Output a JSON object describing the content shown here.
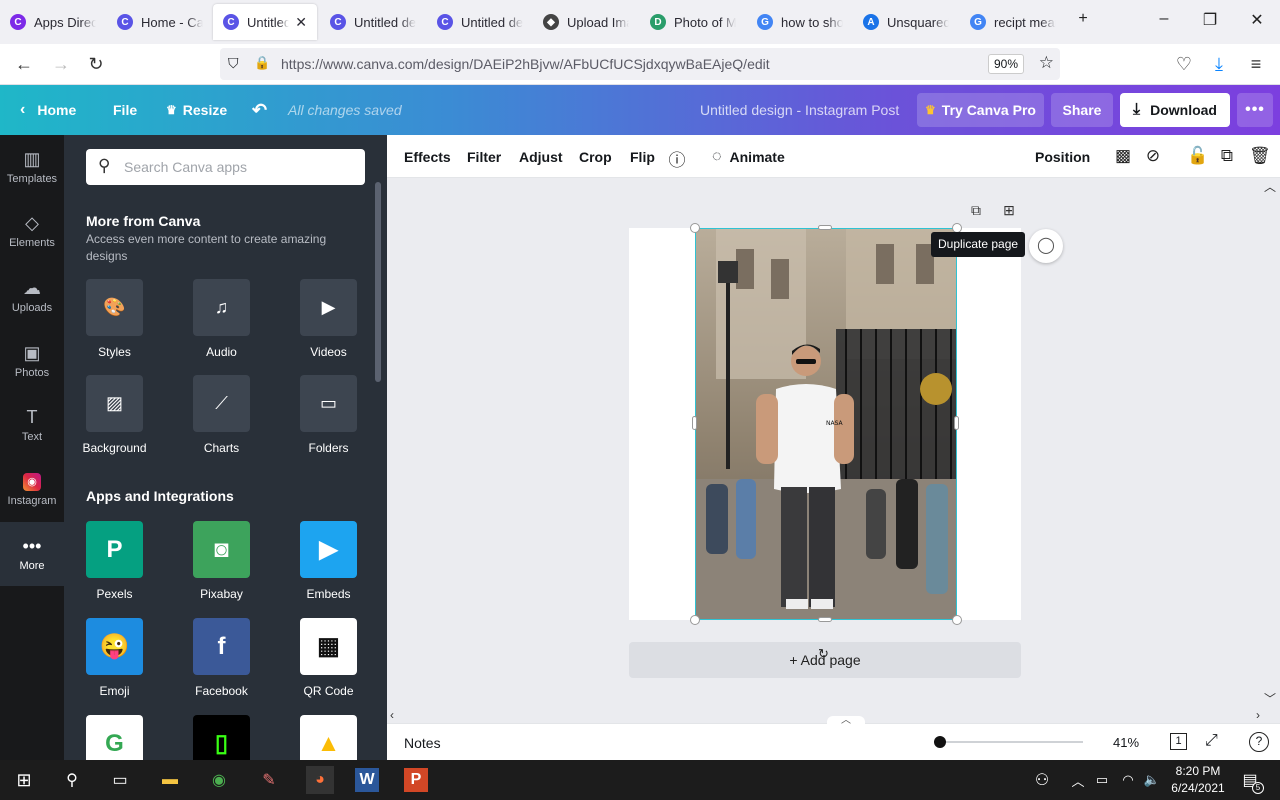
{
  "browser": {
    "tabs": [
      {
        "title": "Apps Directory",
        "fav": "C",
        "color": "#7d2ae8",
        "active": false
      },
      {
        "title": "Home - Canva",
        "fav": "C",
        "color": "#5a54e6",
        "active": false
      },
      {
        "title": "Untitled design",
        "fav": "C",
        "color": "#5a54e6",
        "active": true
      },
      {
        "title": "Untitled design",
        "fav": "C",
        "color": "#5a54e6",
        "active": false
      },
      {
        "title": "Untitled design",
        "fav": "C",
        "color": "#5a54e6",
        "active": false
      },
      {
        "title": "Upload Images",
        "fav": "◆",
        "color": "#444444",
        "active": false
      },
      {
        "title": "Photo of Man",
        "fav": "D",
        "color": "#2a9d6a",
        "active": false
      },
      {
        "title": "how to show",
        "fav": "G",
        "color": "#4285f4",
        "active": false
      },
      {
        "title": "Unsquared",
        "fav": "A",
        "color": "#1a73e8",
        "active": false
      },
      {
        "title": "recipt meaning",
        "fav": "G",
        "color": "#4285f4",
        "active": false
      }
    ],
    "url": "https://www.canva.com/design/DAEiP2hBjvw/AFbUCfUCSjdxqywBaEAjeQ/edit",
    "zoom": "90%"
  },
  "header": {
    "home": "Home",
    "file": "File",
    "resize": "Resize",
    "status": "All changes saved",
    "design_title": "Untitled design - Instagram Post",
    "try_pro": "Try Canva Pro",
    "share": "Share",
    "download": "Download"
  },
  "rail": [
    {
      "label": "Templates",
      "icon": "▥"
    },
    {
      "label": "Elements",
      "icon": "◇"
    },
    {
      "label": "Uploads",
      "icon": "☁"
    },
    {
      "label": "Photos",
      "icon": "▣"
    },
    {
      "label": "Text",
      "icon": "T"
    },
    {
      "label": "Instagram",
      "icon": "◉"
    },
    {
      "label": "More",
      "icon": "•••"
    }
  ],
  "panel": {
    "search_placeholder": "Search Canva apps",
    "more_title": "More from Canva",
    "more_sub": "Access even more content to create amazing designs",
    "more_items": [
      {
        "label": "Styles",
        "icon": "🎨"
      },
      {
        "label": "Audio",
        "icon": "♫"
      },
      {
        "label": "Videos",
        "icon": "▶"
      },
      {
        "label": "Background",
        "icon": "▨"
      },
      {
        "label": "Charts",
        "icon": "⟋"
      },
      {
        "label": "Folders",
        "icon": "▭"
      }
    ],
    "apps_title": "Apps and Integrations",
    "apps": [
      {
        "label": "Pexels",
        "icon": "P",
        "color": "#05a081"
      },
      {
        "label": "Pixabay",
        "icon": "◙",
        "color": "#3da35c"
      },
      {
        "label": "Embeds",
        "icon": "▶",
        "color": "#1da4f0"
      },
      {
        "label": "Emoji",
        "icon": "😜",
        "color": "#1d8ce0"
      },
      {
        "label": "Facebook",
        "icon": "f",
        "color": "#3b5998"
      },
      {
        "label": "QR Code",
        "icon": "▦",
        "color": "#ffffff"
      },
      {
        "label": "",
        "icon": "G",
        "color": "#ffffff"
      },
      {
        "label": "",
        "icon": "▯",
        "color": "#000000"
      },
      {
        "label": "",
        "icon": "▲",
        "color": "#ffffff"
      }
    ]
  },
  "toolbar": {
    "effects": "Effects",
    "filter": "Filter",
    "adjust": "Adjust",
    "crop": "Crop",
    "flip": "Flip",
    "animate": "Animate",
    "position": "Position"
  },
  "canvas": {
    "tooltip": "Duplicate page",
    "add_page": "+ Add page",
    "photo_text": "NASA"
  },
  "footer": {
    "notes": "Notes",
    "zoom": "41%",
    "page": "1"
  },
  "taskbar": {
    "time": "8:20 PM",
    "date": "6/24/2021",
    "notif": "5"
  }
}
